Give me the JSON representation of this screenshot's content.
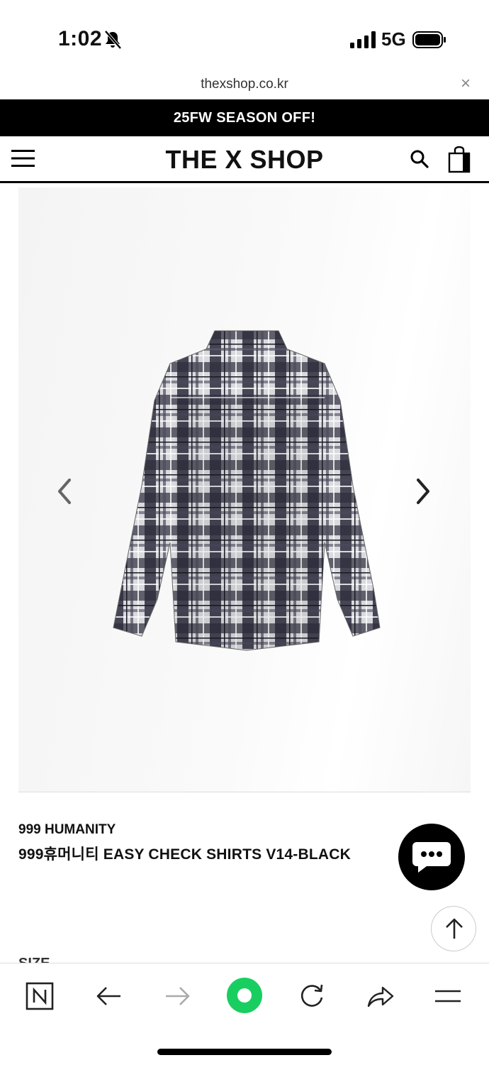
{
  "status_bar": {
    "time": "1:02",
    "network": "5G",
    "icons": [
      "bell-slash-icon",
      "signal-icon",
      "battery-icon"
    ]
  },
  "browser": {
    "url": "thexshop.co.kr",
    "close_label": "×"
  },
  "promo": {
    "text": "25FW SEASON OFF!"
  },
  "site_header": {
    "logo": "THE X SHOP",
    "icons": [
      "menu-icon",
      "search-icon",
      "shopping-bag-icon"
    ]
  },
  "product": {
    "image_icon": "plaid-shirt-image",
    "brand": "999 HUMANITY",
    "name": "999휴머니티 EASY CHECK SHIRTS V14-BLACK",
    "size_label": "SIZE"
  },
  "floating": {
    "chat_icon": "chat-bubble-icon",
    "top_icon": "arrow-up-icon"
  },
  "toolbar": {
    "items": [
      "naver-n-icon",
      "back-arrow-icon",
      "forward-arrow-icon",
      "green-dot-icon",
      "refresh-icon",
      "share-icon",
      "menu-lines-icon"
    ]
  },
  "colors": {
    "banner_bg": "#000000",
    "accent_green": "#19ce60"
  }
}
